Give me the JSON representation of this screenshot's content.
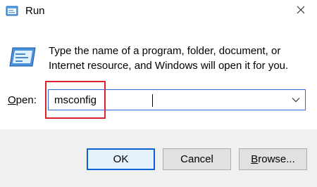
{
  "window": {
    "title": "Run",
    "close_icon": "close-icon",
    "app_icon": "run-app-icon"
  },
  "body": {
    "description": "Type the name of a program, folder, document, or Internet resource, and Windows will open it for you.",
    "open_label_accel": "O",
    "open_label_rest": "pen:",
    "open_value": "msconfig",
    "dropdown_icon": "chevron-down-icon"
  },
  "buttons": {
    "ok": "OK",
    "cancel": "Cancel",
    "browse_accel": "B",
    "browse_rest": "rowse..."
  },
  "colors": {
    "highlight": "#d9232e",
    "focus_border": "#2f6fdc",
    "default_button_border": "#0a64d8",
    "footer_bg": "#f0f0f0"
  }
}
